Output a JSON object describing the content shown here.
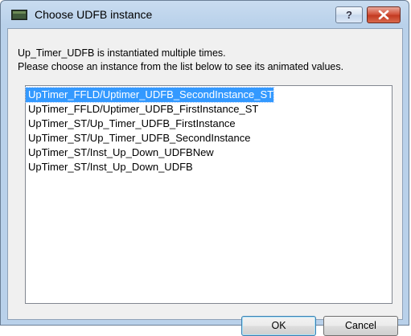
{
  "window": {
    "title": "Choose UDFB instance",
    "help_label": "?"
  },
  "message": {
    "line1": "Up_Timer_UDFB is instantiated multiple times.",
    "line2": "Please choose an instance from the list below to see its animated values."
  },
  "instances": [
    {
      "label": "UpTimer_FFLD/Uptimer_UDFB_SecondInstance_ST",
      "selected": true
    },
    {
      "label": "UpTimer_FFLD/Uptimer_UDFB_FirstInstance_ST",
      "selected": false
    },
    {
      "label": "UpTimer_ST/Up_Timer_UDFB_FirstInstance",
      "selected": false
    },
    {
      "label": "UpTimer_ST/Up_Timer_UDFB_SecondInstance",
      "selected": false
    },
    {
      "label": "UpTimer_ST/Inst_Up_Down_UDFBNew",
      "selected": false
    },
    {
      "label": "UpTimer_ST/Inst_Up_Down_UDFB",
      "selected": false
    }
  ],
  "buttons": {
    "ok_label": "OK",
    "cancel_label": "Cancel"
  },
  "colors": {
    "selection": "#3399ff",
    "close_button": "#c33a22"
  }
}
